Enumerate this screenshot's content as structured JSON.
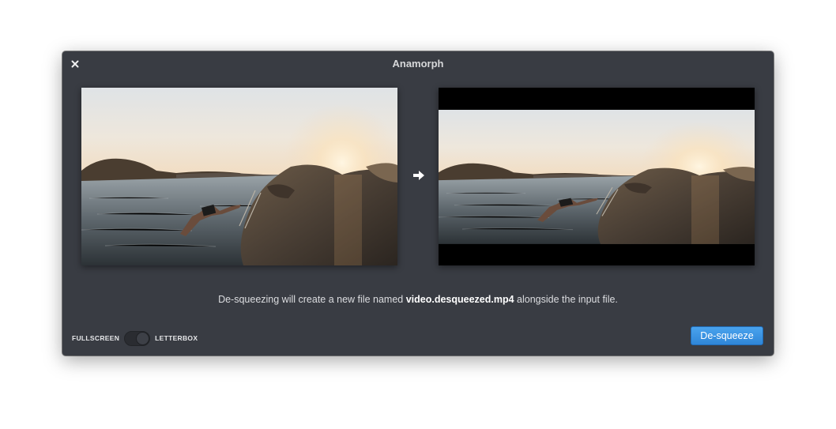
{
  "window": {
    "title": "Anamorph"
  },
  "previews": {
    "input": {
      "label": "input-preview"
    },
    "output": {
      "label": "output-preview",
      "letterbox": true
    }
  },
  "info": {
    "prefix": "De-squeezing will create a new file named ",
    "filename": "video.desqueezed.mp4",
    "suffix": " alongside the input file."
  },
  "mode_switch": {
    "left_label": "FULLSCREEN",
    "right_label": "LETTERBOX",
    "selected": "LETTERBOX"
  },
  "actions": {
    "desqueeze_label": "De-squeeze"
  },
  "colors": {
    "window_bg": "#393c43",
    "accent": "#3592e2"
  },
  "icons": {
    "close": "close-icon",
    "arrow": "arrow-right-icon"
  }
}
